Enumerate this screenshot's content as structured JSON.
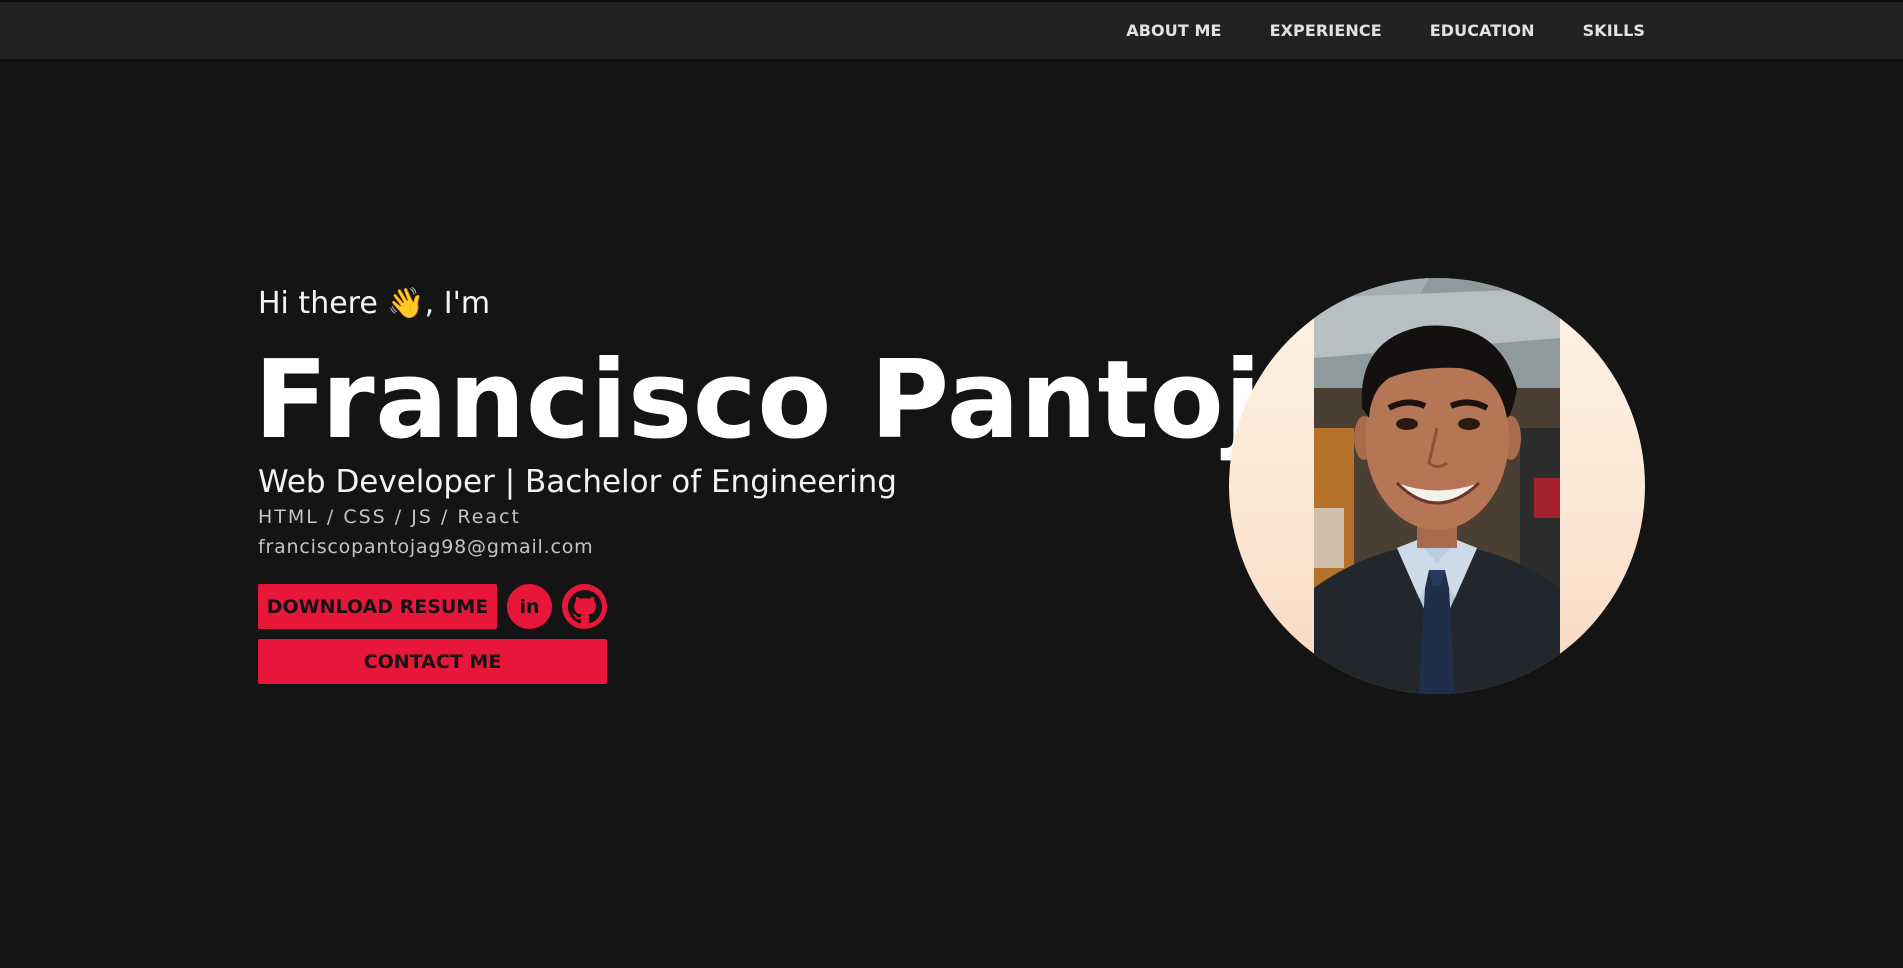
{
  "nav": {
    "items": [
      "ABOUT ME",
      "EXPERIENCE",
      "EDUCATION",
      "SKILLS"
    ]
  },
  "hero": {
    "greeting": "Hi there 👋, I'm",
    "name": "Francisco Pantoja",
    "subtitle": "Web Developer | Bachelor of Engineering",
    "skills": "HTML / CSS / JS / React",
    "email": "franciscopantojag98@gmail.com",
    "download_resume_label": "DOWNLOAD RESUME",
    "contact_label": "CONTACT ME",
    "linkedin_label": "in"
  },
  "icons": {
    "linkedin": "linkedin-icon",
    "github": "github-icon",
    "wave": "waving-hand-emoji"
  },
  "colors": {
    "background": "#141414",
    "navbar": "#222222",
    "accent": "#e8173a",
    "text_primary": "#ffffff",
    "text_secondary": "#c4c4c4"
  }
}
